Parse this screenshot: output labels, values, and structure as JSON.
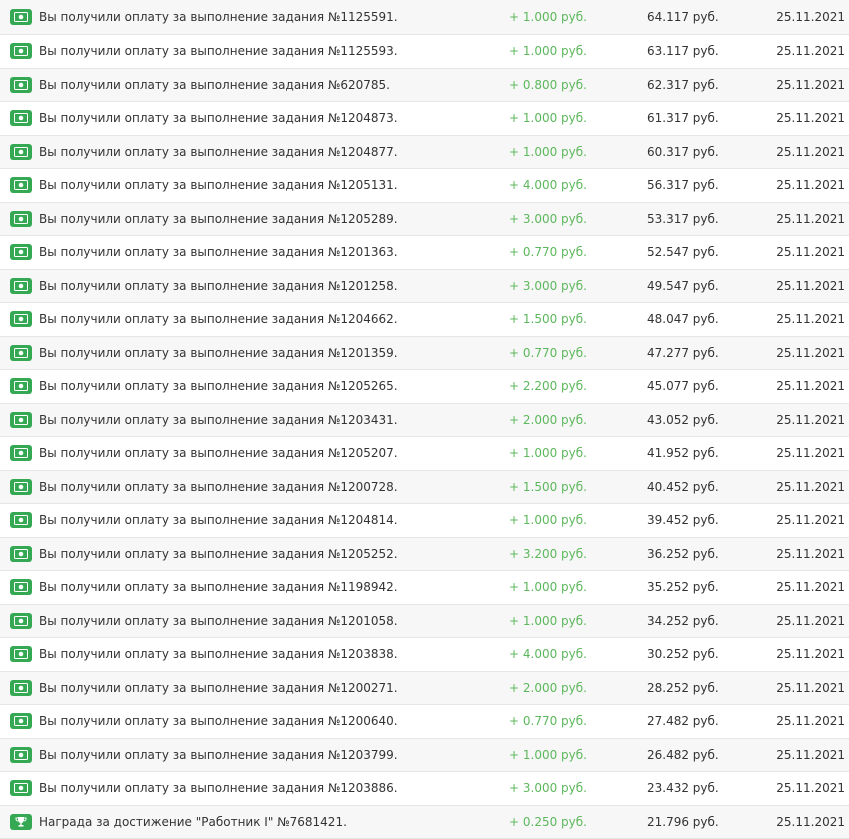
{
  "colors": {
    "accent_green": "#34a853",
    "amount_green": "#5cb85c",
    "text": "#333333",
    "row_alt": "#f7f7f7"
  },
  "transactions": [
    {
      "icon": "money-icon",
      "desc": "Вы получили оплату за выполнение задания №1125591.",
      "amount": "+ 1.000 руб.",
      "balance": "64.117 руб.",
      "date": "25.11.2021"
    },
    {
      "icon": "money-icon",
      "desc": "Вы получили оплату за выполнение задания №1125593.",
      "amount": "+ 1.000 руб.",
      "balance": "63.117 руб.",
      "date": "25.11.2021"
    },
    {
      "icon": "money-icon",
      "desc": "Вы получили оплату за выполнение задания №620785.",
      "amount": "+ 0.800 руб.",
      "balance": "62.317 руб.",
      "date": "25.11.2021"
    },
    {
      "icon": "money-icon",
      "desc": "Вы получили оплату за выполнение задания №1204873.",
      "amount": "+ 1.000 руб.",
      "balance": "61.317 руб.",
      "date": "25.11.2021"
    },
    {
      "icon": "money-icon",
      "desc": "Вы получили оплату за выполнение задания №1204877.",
      "amount": "+ 1.000 руб.",
      "balance": "60.317 руб.",
      "date": "25.11.2021"
    },
    {
      "icon": "money-icon",
      "desc": "Вы получили оплату за выполнение задания №1205131.",
      "amount": "+ 4.000 руб.",
      "balance": "56.317 руб.",
      "date": "25.11.2021"
    },
    {
      "icon": "money-icon",
      "desc": "Вы получили оплату за выполнение задания №1205289.",
      "amount": "+ 3.000 руб.",
      "balance": "53.317 руб.",
      "date": "25.11.2021"
    },
    {
      "icon": "money-icon",
      "desc": "Вы получили оплату за выполнение задания №1201363.",
      "amount": "+ 0.770 руб.",
      "balance": "52.547 руб.",
      "date": "25.11.2021"
    },
    {
      "icon": "money-icon",
      "desc": "Вы получили оплату за выполнение задания №1201258.",
      "amount": "+ 3.000 руб.",
      "balance": "49.547 руб.",
      "date": "25.11.2021"
    },
    {
      "icon": "money-icon",
      "desc": "Вы получили оплату за выполнение задания №1204662.",
      "amount": "+ 1.500 руб.",
      "balance": "48.047 руб.",
      "date": "25.11.2021"
    },
    {
      "icon": "money-icon",
      "desc": "Вы получили оплату за выполнение задания №1201359.",
      "amount": "+ 0.770 руб.",
      "balance": "47.277 руб.",
      "date": "25.11.2021"
    },
    {
      "icon": "money-icon",
      "desc": "Вы получили оплату за выполнение задания №1205265.",
      "amount": "+ 2.200 руб.",
      "balance": "45.077 руб.",
      "date": "25.11.2021"
    },
    {
      "icon": "money-icon",
      "desc": "Вы получили оплату за выполнение задания №1203431.",
      "amount": "+ 2.000 руб.",
      "balance": "43.052 руб.",
      "date": "25.11.2021"
    },
    {
      "icon": "money-icon",
      "desc": "Вы получили оплату за выполнение задания №1205207.",
      "amount": "+ 1.000 руб.",
      "balance": "41.952 руб.",
      "date": "25.11.2021"
    },
    {
      "icon": "money-icon",
      "desc": "Вы получили оплату за выполнение задания №1200728.",
      "amount": "+ 1.500 руб.",
      "balance": "40.452 руб.",
      "date": "25.11.2021"
    },
    {
      "icon": "money-icon",
      "desc": "Вы получили оплату за выполнение задания №1204814.",
      "amount": "+ 1.000 руб.",
      "balance": "39.452 руб.",
      "date": "25.11.2021"
    },
    {
      "icon": "money-icon",
      "desc": "Вы получили оплату за выполнение задания №1205252.",
      "amount": "+ 3.200 руб.",
      "balance": "36.252 руб.",
      "date": "25.11.2021"
    },
    {
      "icon": "money-icon",
      "desc": "Вы получили оплату за выполнение задания №1198942.",
      "amount": "+ 1.000 руб.",
      "balance": "35.252 руб.",
      "date": "25.11.2021"
    },
    {
      "icon": "money-icon",
      "desc": "Вы получили оплату за выполнение задания №1201058.",
      "amount": "+ 1.000 руб.",
      "balance": "34.252 руб.",
      "date": "25.11.2021"
    },
    {
      "icon": "money-icon",
      "desc": "Вы получили оплату за выполнение задания №1203838.",
      "amount": "+ 4.000 руб.",
      "balance": "30.252 руб.",
      "date": "25.11.2021"
    },
    {
      "icon": "money-icon",
      "desc": "Вы получили оплату за выполнение задания №1200271.",
      "amount": "+ 2.000 руб.",
      "balance": "28.252 руб.",
      "date": "25.11.2021"
    },
    {
      "icon": "money-icon",
      "desc": "Вы получили оплату за выполнение задания №1200640.",
      "amount": "+ 0.770 руб.",
      "balance": "27.482 руб.",
      "date": "25.11.2021"
    },
    {
      "icon": "money-icon",
      "desc": "Вы получили оплату за выполнение задания №1203799.",
      "amount": "+ 1.000 руб.",
      "balance": "26.482 руб.",
      "date": "25.11.2021"
    },
    {
      "icon": "money-icon",
      "desc": "Вы получили оплату за выполнение задания №1203886.",
      "amount": "+ 3.000 руб.",
      "balance": "23.432 руб.",
      "date": "25.11.2021"
    },
    {
      "icon": "trophy-icon",
      "desc": "Награда за достижение \"Работник I\" №7681421.",
      "amount": "+ 0.250 руб.",
      "balance": "21.796 руб.",
      "date": "25.11.2021"
    }
  ]
}
